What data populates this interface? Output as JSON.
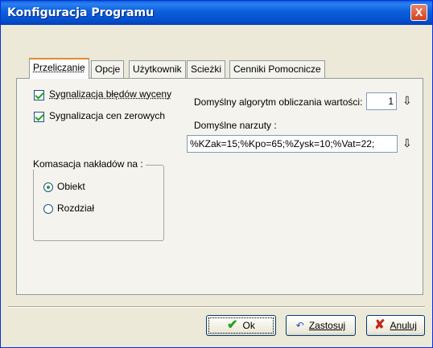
{
  "window": {
    "title": "Konfiguracja Programu",
    "close_label": "X"
  },
  "tabs": [
    {
      "label": "Przeliczanie"
    },
    {
      "label": "Opcje"
    },
    {
      "label": "Użytkownik"
    },
    {
      "label": "Scieżki"
    },
    {
      "label": "Cenniki Pomocnicze"
    }
  ],
  "options": {
    "signal_errors": {
      "label": "Sygnalizacja błędów wyceny",
      "checked": true
    },
    "signal_zero_prices": {
      "label": "Sygnalizacja cen zerowych",
      "checked": true
    }
  },
  "komasacja": {
    "legend": "Komasacja nakładów na :",
    "options": [
      {
        "label": "Obiekt",
        "selected": true
      },
      {
        "label": "Rozdział",
        "selected": false
      }
    ]
  },
  "algorithm": {
    "label": "Domyślny algorytm obliczania wartości:",
    "value": "1",
    "arrow_icon": "down-arrow-icon"
  },
  "markups": {
    "label": "Domyślne narzuty :",
    "value": "%KZak=15;%Kpo=65;%Zysk=10;%Vat=22;",
    "arrow_icon": "down-arrow-icon"
  },
  "buttons": {
    "ok": "Ok",
    "apply": "Zastosuj",
    "cancel": "Anuluj"
  },
  "colors": {
    "title_bar": "#0a5fd9",
    "close": "#d2411f",
    "active_tab_accent": "#e68b2c",
    "ok_check": "#21a121",
    "cancel_x": "#c0281a"
  }
}
